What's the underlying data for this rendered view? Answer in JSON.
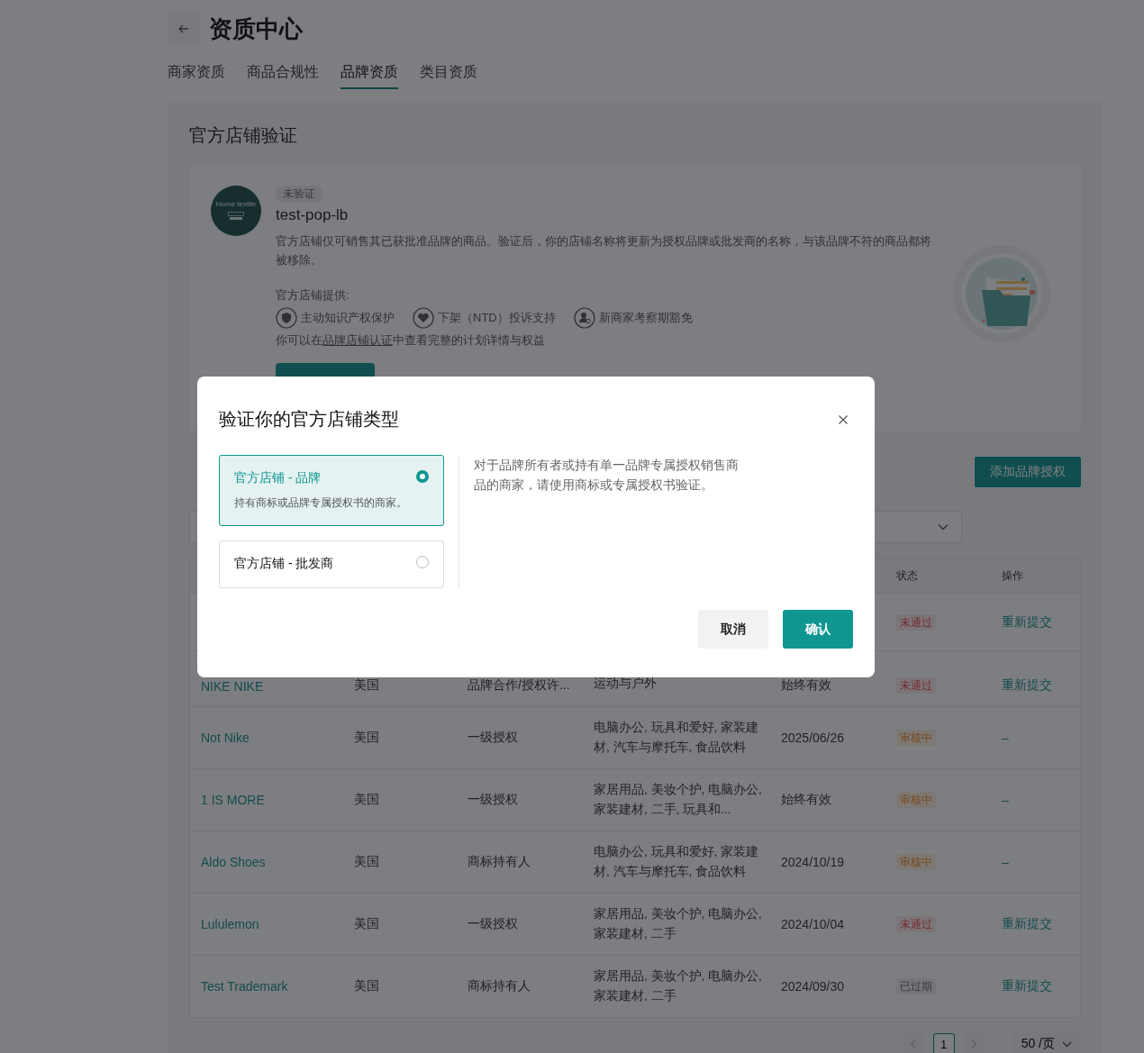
{
  "page": {
    "title": "资质中心",
    "tabs": [
      {
        "label": "商家资质",
        "selected": false
      },
      {
        "label": "商品合规性",
        "selected": false
      },
      {
        "label": "品牌资质",
        "selected": true
      },
      {
        "label": "类目资质",
        "selected": false
      }
    ]
  },
  "official_store": {
    "title": "官方店铺验证",
    "avatar_text": "Home textile",
    "status_tag": "未验证",
    "store_name": "test-pop-lb",
    "description": "官方店铺仅可销售其已获批准品牌的商品。验证后，你的店铺名称将更新为授权品牌或批发商的名称，与该品牌不符的商品都将被移除。",
    "benefits_label": "官方店铺提供:",
    "benefits": [
      {
        "kind": "shield",
        "label": "主动知识产权保护"
      },
      {
        "kind": "heart",
        "label": "下架（NTD）投诉支持"
      },
      {
        "kind": "person",
        "label": "新商家考察期豁免"
      }
    ],
    "footer_prefix": "你可以在",
    "footer_link": "品牌店铺认证",
    "footer_suffix": "中查看完整的计划详情与权益"
  },
  "brand_section": {
    "add_button": "添加品牌授权"
  },
  "table": {
    "columns": [
      {
        "label": "状态"
      },
      {
        "label": "操作"
      }
    ],
    "rows": [
      {
        "status": {
          "label": "未通过",
          "kind": "rejected"
        },
        "action": "重新提交"
      },
      {
        "name": "NIKE NIKE",
        "region": "美国",
        "type": "品牌合作/授权许...",
        "categories": "运动与户外",
        "validity": "始终有效",
        "status": {
          "label": "未通过",
          "kind": "rejected"
        },
        "action": "重新提交"
      },
      {
        "name": "Not Nike",
        "region": "美国",
        "type": "一级授权",
        "categories": "电脑办公, 玩具和爱好, 家装建材, 汽车与摩托车, 食品饮料",
        "validity": "2025/06/26",
        "status": {
          "label": "审核中",
          "kind": "reviewing"
        },
        "action": "–"
      },
      {
        "name": "1 IS MORE",
        "region": "美国",
        "type": "一级授权",
        "categories": "家居用品, 美妆个护, 电脑办公, 家装建材, 二手, 玩具和...",
        "validity": "始终有效",
        "status": {
          "label": "审核中",
          "kind": "reviewing"
        },
        "action": "–"
      },
      {
        "name": "Aldo Shoes",
        "region": "美国",
        "type": "商标持有人",
        "categories": "电脑办公, 玩具和爱好, 家装建材, 汽车与摩托车, 食品饮料",
        "validity": "2024/10/19",
        "status": {
          "label": "审核中",
          "kind": "reviewing"
        },
        "action": "–"
      },
      {
        "name": "Lululemon",
        "region": "美国",
        "type": "一级授权",
        "categories": "家居用品, 美妆个护, 电脑办公, 家装建材, 二手",
        "validity": "2024/10/04",
        "status": {
          "label": "未通过",
          "kind": "rejected"
        },
        "action": "重新提交"
      },
      {
        "name": "Test Trademark",
        "region": "美国",
        "type": "商标持有人",
        "categories": "家居用品, 美妆个护, 电脑办公, 家装建材, 二手",
        "validity": "2024/09/30",
        "status": {
          "label": "已过期",
          "kind": "expired"
        },
        "action": "重新提交"
      }
    ]
  },
  "pagination": {
    "pages": [
      {
        "label": "1",
        "selected": true
      }
    ],
    "page_size": "50 /页"
  },
  "dialog": {
    "title": "验证你的官方店铺类型",
    "options": [
      {
        "title": "官方店铺 - 品牌",
        "subtitle": "持有商标或品牌专属授权书的商家。",
        "selected": true
      },
      {
        "title": "官方店铺 - 批发商",
        "selected": false
      }
    ],
    "description": "对于品牌所有者或持有单一品牌专属授权销售商品的商家，请使用商标或专属授权书验证。",
    "buttons": [
      {
        "label": "取消",
        "kind": "secondary"
      },
      {
        "label": "确认",
        "kind": "primary"
      }
    ]
  }
}
